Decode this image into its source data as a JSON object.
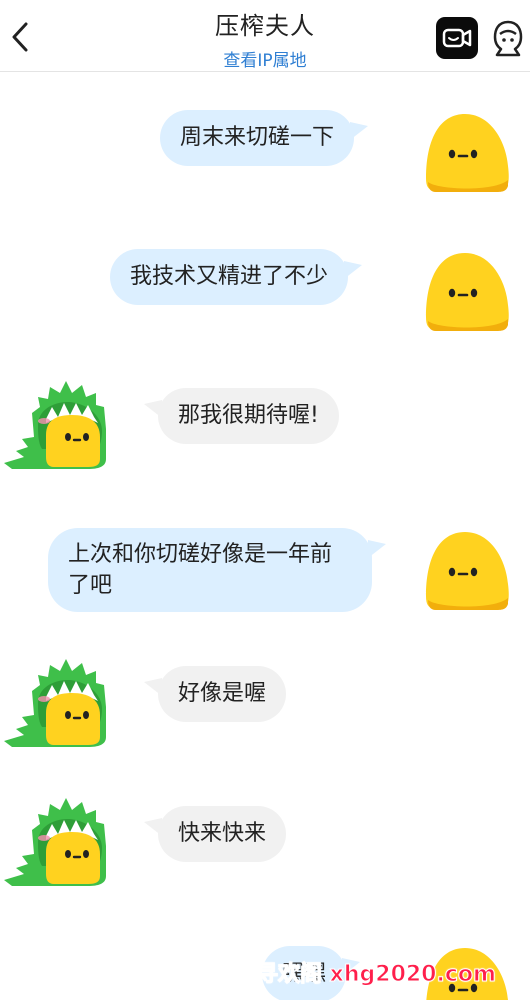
{
  "header": {
    "title": "压榨夫人",
    "subtitle": "查看IP属地"
  },
  "icons": {
    "back": "chevron-left-icon",
    "video": "video-call-icon",
    "profile": "user-profile-icon"
  },
  "messages": [
    {
      "side": "out",
      "text": "周末来切磋一下"
    },
    {
      "side": "out",
      "text": "我技术又精进了不少"
    },
    {
      "side": "in",
      "text": "那我很期待喔!"
    },
    {
      "side": "out",
      "text": "上次和你切磋好像是一年前了吧"
    },
    {
      "side": "in",
      "text": "好像是喔"
    },
    {
      "side": "in",
      "text": "快来快来"
    },
    {
      "side": "out",
      "text": "嘿嘿"
    }
  ],
  "watermark": "寻欢阁 xhg2020.com",
  "colors": {
    "outgoing_bubble": "#dcefff",
    "incoming_bubble": "#f1f1f1",
    "link_blue": "#2f7fd3",
    "watermark": "#ff1f4b"
  }
}
